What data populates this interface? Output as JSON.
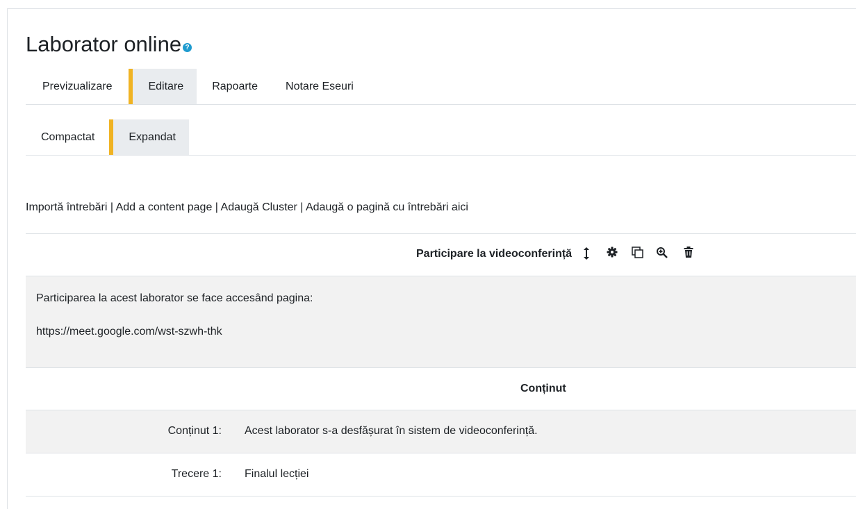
{
  "title": "Laborator online",
  "help_icon": "question-circle-icon",
  "main_tabs": [
    {
      "label": "Previzualizare",
      "active": false
    },
    {
      "label": "Editare",
      "active": true
    },
    {
      "label": "Rapoarte",
      "active": false
    },
    {
      "label": "Notare Eseuri",
      "active": false
    }
  ],
  "view_tabs": [
    {
      "label": "Compactat",
      "active": false
    },
    {
      "label": "Expandat",
      "active": true
    }
  ],
  "action_links": [
    "Importă întrebări",
    "Add a content page",
    "Adaugă Cluster",
    "Adaugă o pagină cu întrebări aici"
  ],
  "link_separator": " | ",
  "page": {
    "title": "Participare la videoconferință",
    "actions": [
      "move-icon",
      "gear-icon",
      "duplicate-icon",
      "zoom-in-icon",
      "trash-icon"
    ],
    "content_lines": [
      "Participarea la acest laborator se face accesând pagina:",
      "https://meet.google.com/wst-szwh-thk"
    ]
  },
  "table": {
    "header": "Conținut",
    "rows": [
      {
        "label": "Conținut 1:",
        "value": "Acest laborator s-a desfășurat în sistem de videoconferință."
      },
      {
        "label": "Trecere 1:",
        "value": "Finalul lecției"
      }
    ]
  },
  "colors": {
    "accent": "#f0b323",
    "active_tab_bg": "#e9ecef",
    "help_icon": "#1f9bcf",
    "shaded_row": "#f2f2f2"
  }
}
